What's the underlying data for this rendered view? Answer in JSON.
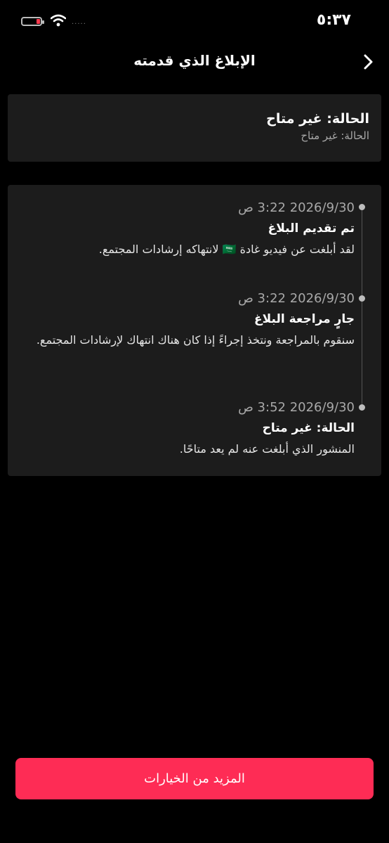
{
  "status_bar": {
    "time": "٥:٣٧",
    "signal": "....."
  },
  "header": {
    "title": "الإبلاغ الذي قدمته"
  },
  "status_card": {
    "title": "الحالة: غير متاح",
    "subtitle": "الحالة: غير متاح"
  },
  "timeline": [
    {
      "time": "2026/9/30 3:22 ص",
      "title": "تم تقديم البلاغ",
      "description": "لقد أبلغت عن فيديو غادة 🇸🇦 لانتهاكه إرشادات المجتمع."
    },
    {
      "time": "2026/9/30 3:22 ص",
      "title": "جارٍ مراجعة البلاغ",
      "description": "سنقوم بالمراجعة ونتخذ إجراءً إذا كان هناك انتهاك لإرشادات المجتمع."
    },
    {
      "time": "2026/9/30 3:52 ص",
      "title": "الحالة: غير متاح",
      "description": "المنشور الذي أبلغت عنه لم يعد متاحًا."
    }
  ],
  "footer": {
    "more_options_label": "المزيد من الخيارات"
  },
  "colors": {
    "accent": "#fe2c55",
    "card_bg": "#1c1c1c",
    "background": "#000000"
  },
  "battery_level_fraction": 0.15
}
